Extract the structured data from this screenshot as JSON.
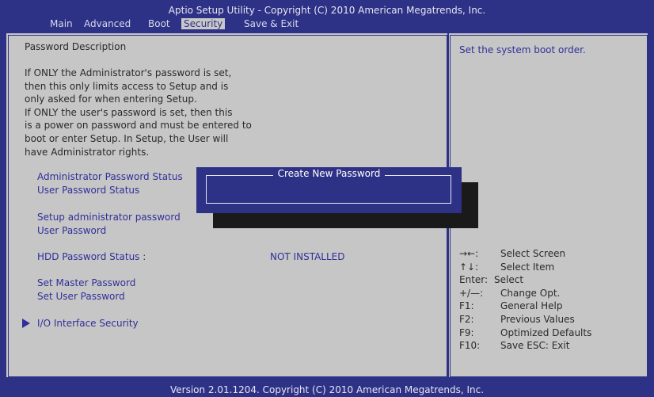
{
  "header": {
    "title": "Aptio Setup Utility - Copyright (C) 2010 American Megatrends, Inc."
  },
  "menu": [
    {
      "label": "Main"
    },
    {
      "label": "Advanced"
    },
    {
      "label": "Boot"
    },
    {
      "label": "Security",
      "active": true
    },
    {
      "label": "Save & Exit"
    }
  ],
  "description": {
    "heading": "Password Description",
    "lines": [
      "If ONLY the Administrator's password is set,",
      "then this only limits access to Setup and is",
      "only asked for when entering Setup.",
      "If ONLY the user's password is set, then this",
      "is a power on password and must be entered to",
      "boot or enter Setup. In Setup, the User will",
      "have Administrator rights."
    ]
  },
  "items": {
    "admin_status": "Administrator Password Status",
    "user_status": "User Password Status",
    "setup_admin": "Setup administrator password",
    "user_password": "User Password",
    "hdd_label": "HDD Password Status :",
    "hdd_value": "NOT INSTALLED",
    "master_password": "Set Master Password",
    "set_user_password": "Set User Password",
    "io_security": "I/O Interface Security"
  },
  "help_text": "Set the system boot order.",
  "dialog": {
    "title": "Create New Password",
    "value": ""
  },
  "keys": [
    {
      "key": "→←:",
      "desc": "Select Screen"
    },
    {
      "key": "↑↓:",
      "desc": "Select Item"
    },
    {
      "key": "Enter:",
      "desc": "Select"
    },
    {
      "key": "+/—:",
      "desc": "Change Opt."
    },
    {
      "key": "F1:",
      "desc": "General Help"
    },
    {
      "key": "F2:",
      "desc": "Previous Values"
    },
    {
      "key": "F9:",
      "desc": "Optimized Defaults"
    },
    {
      "key": "F10:",
      "desc": "Save   ESC: Exit"
    }
  ],
  "footer": "Version 2.01.1204. Copyright (C) 2010 American Megatrends, Inc.",
  "colors": {
    "background": "#2e3286",
    "panel": "#c6c6c6",
    "item_text": "#30309a"
  }
}
